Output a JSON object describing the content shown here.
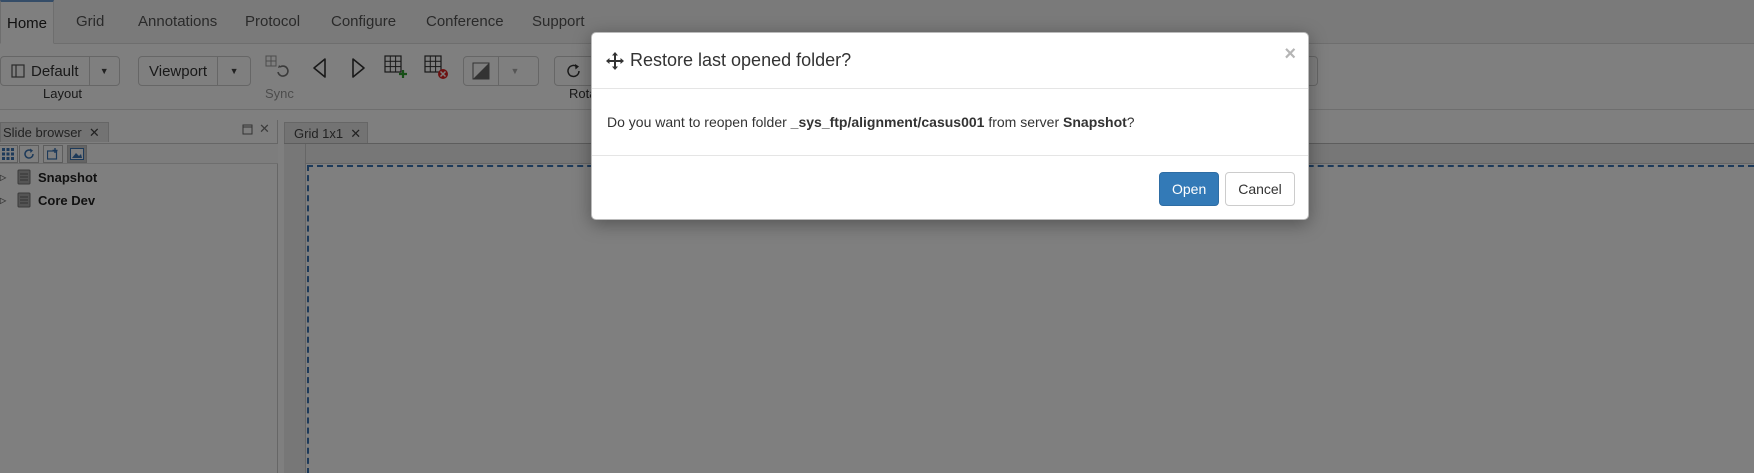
{
  "menu": {
    "tabs": [
      {
        "label": "Home"
      },
      {
        "label": "Grid"
      },
      {
        "label": "Annotations"
      },
      {
        "label": "Protocol"
      },
      {
        "label": "Configure"
      },
      {
        "label": "Conference"
      },
      {
        "label": "Support"
      }
    ]
  },
  "ribbon": {
    "layout_button": "Default",
    "layout_label": "Layout",
    "viewport_button": "Viewport",
    "sync_label": "Sync",
    "rotate_label": "Rota"
  },
  "slide_browser": {
    "tab_label": "Slide browser",
    "items": [
      {
        "label": "Snapshot"
      },
      {
        "label": "Core Dev"
      }
    ]
  },
  "viewer": {
    "tab_label": "Grid 1x1"
  },
  "dialog": {
    "title": "Restore last opened folder?",
    "close_symbol": "×",
    "message_prefix": "Do you want to reopen folder",
    "folder_path": "_sys_ftp/alignment/casus001",
    "message_middle": "from server",
    "server_name": "Snapshot",
    "message_suffix": "?",
    "open_button": "Open",
    "cancel_button": "Cancel"
  },
  "colors": {
    "primary_button": "#337ab7",
    "backdrop": "rgba(0,0,0,0.5)",
    "viewport_border": "#3b74b4"
  }
}
